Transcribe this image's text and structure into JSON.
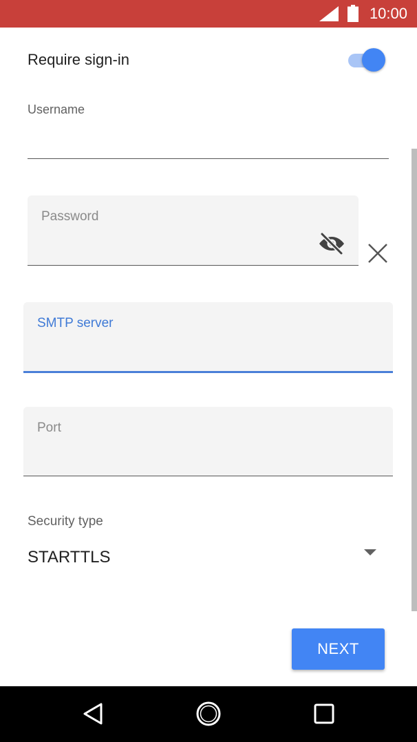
{
  "status_bar": {
    "time": "10:00",
    "background": "#c8403a",
    "icons": [
      "signal-icon",
      "battery-icon"
    ]
  },
  "form": {
    "require_signin": {
      "label": "Require sign-in",
      "enabled": true
    },
    "username": {
      "label": "Username",
      "value": ""
    },
    "password": {
      "label": "Password",
      "value": "",
      "icons": [
        "visibility-off-icon",
        "clear-icon"
      ]
    },
    "smtp_server": {
      "label": "SMTP server",
      "value": "",
      "focused": true
    },
    "port": {
      "label": "Port",
      "value": ""
    },
    "security_type": {
      "label": "Security type",
      "value": "STARTTLS"
    },
    "next_label": "NEXT"
  },
  "colors": {
    "accent": "#4285f4",
    "focus_label": "#3f7ad6"
  },
  "nav_bar": {
    "icons": [
      "back-icon",
      "home-icon",
      "recents-icon"
    ]
  }
}
